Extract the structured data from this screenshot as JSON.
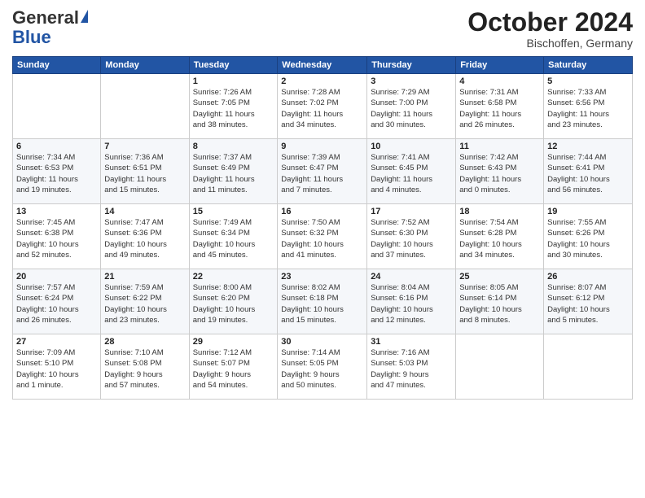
{
  "header": {
    "logo_general": "General",
    "logo_blue": "Blue",
    "month_title": "October 2024",
    "location": "Bischoffen, Germany"
  },
  "weekdays": [
    "Sunday",
    "Monday",
    "Tuesday",
    "Wednesday",
    "Thursday",
    "Friday",
    "Saturday"
  ],
  "weeks": [
    [
      {
        "day": "",
        "info": ""
      },
      {
        "day": "",
        "info": ""
      },
      {
        "day": "1",
        "info": "Sunrise: 7:26 AM\nSunset: 7:05 PM\nDaylight: 11 hours\nand 38 minutes."
      },
      {
        "day": "2",
        "info": "Sunrise: 7:28 AM\nSunset: 7:02 PM\nDaylight: 11 hours\nand 34 minutes."
      },
      {
        "day": "3",
        "info": "Sunrise: 7:29 AM\nSunset: 7:00 PM\nDaylight: 11 hours\nand 30 minutes."
      },
      {
        "day": "4",
        "info": "Sunrise: 7:31 AM\nSunset: 6:58 PM\nDaylight: 11 hours\nand 26 minutes."
      },
      {
        "day": "5",
        "info": "Sunrise: 7:33 AM\nSunset: 6:56 PM\nDaylight: 11 hours\nand 23 minutes."
      }
    ],
    [
      {
        "day": "6",
        "info": "Sunrise: 7:34 AM\nSunset: 6:53 PM\nDaylight: 11 hours\nand 19 minutes."
      },
      {
        "day": "7",
        "info": "Sunrise: 7:36 AM\nSunset: 6:51 PM\nDaylight: 11 hours\nand 15 minutes."
      },
      {
        "day": "8",
        "info": "Sunrise: 7:37 AM\nSunset: 6:49 PM\nDaylight: 11 hours\nand 11 minutes."
      },
      {
        "day": "9",
        "info": "Sunrise: 7:39 AM\nSunset: 6:47 PM\nDaylight: 11 hours\nand 7 minutes."
      },
      {
        "day": "10",
        "info": "Sunrise: 7:41 AM\nSunset: 6:45 PM\nDaylight: 11 hours\nand 4 minutes."
      },
      {
        "day": "11",
        "info": "Sunrise: 7:42 AM\nSunset: 6:43 PM\nDaylight: 11 hours\nand 0 minutes."
      },
      {
        "day": "12",
        "info": "Sunrise: 7:44 AM\nSunset: 6:41 PM\nDaylight: 10 hours\nand 56 minutes."
      }
    ],
    [
      {
        "day": "13",
        "info": "Sunrise: 7:45 AM\nSunset: 6:38 PM\nDaylight: 10 hours\nand 52 minutes."
      },
      {
        "day": "14",
        "info": "Sunrise: 7:47 AM\nSunset: 6:36 PM\nDaylight: 10 hours\nand 49 minutes."
      },
      {
        "day": "15",
        "info": "Sunrise: 7:49 AM\nSunset: 6:34 PM\nDaylight: 10 hours\nand 45 minutes."
      },
      {
        "day": "16",
        "info": "Sunrise: 7:50 AM\nSunset: 6:32 PM\nDaylight: 10 hours\nand 41 minutes."
      },
      {
        "day": "17",
        "info": "Sunrise: 7:52 AM\nSunset: 6:30 PM\nDaylight: 10 hours\nand 37 minutes."
      },
      {
        "day": "18",
        "info": "Sunrise: 7:54 AM\nSunset: 6:28 PM\nDaylight: 10 hours\nand 34 minutes."
      },
      {
        "day": "19",
        "info": "Sunrise: 7:55 AM\nSunset: 6:26 PM\nDaylight: 10 hours\nand 30 minutes."
      }
    ],
    [
      {
        "day": "20",
        "info": "Sunrise: 7:57 AM\nSunset: 6:24 PM\nDaylight: 10 hours\nand 26 minutes."
      },
      {
        "day": "21",
        "info": "Sunrise: 7:59 AM\nSunset: 6:22 PM\nDaylight: 10 hours\nand 23 minutes."
      },
      {
        "day": "22",
        "info": "Sunrise: 8:00 AM\nSunset: 6:20 PM\nDaylight: 10 hours\nand 19 minutes."
      },
      {
        "day": "23",
        "info": "Sunrise: 8:02 AM\nSunset: 6:18 PM\nDaylight: 10 hours\nand 15 minutes."
      },
      {
        "day": "24",
        "info": "Sunrise: 8:04 AM\nSunset: 6:16 PM\nDaylight: 10 hours\nand 12 minutes."
      },
      {
        "day": "25",
        "info": "Sunrise: 8:05 AM\nSunset: 6:14 PM\nDaylight: 10 hours\nand 8 minutes."
      },
      {
        "day": "26",
        "info": "Sunrise: 8:07 AM\nSunset: 6:12 PM\nDaylight: 10 hours\nand 5 minutes."
      }
    ],
    [
      {
        "day": "27",
        "info": "Sunrise: 7:09 AM\nSunset: 5:10 PM\nDaylight: 10 hours\nand 1 minute."
      },
      {
        "day": "28",
        "info": "Sunrise: 7:10 AM\nSunset: 5:08 PM\nDaylight: 9 hours\nand 57 minutes."
      },
      {
        "day": "29",
        "info": "Sunrise: 7:12 AM\nSunset: 5:07 PM\nDaylight: 9 hours\nand 54 minutes."
      },
      {
        "day": "30",
        "info": "Sunrise: 7:14 AM\nSunset: 5:05 PM\nDaylight: 9 hours\nand 50 minutes."
      },
      {
        "day": "31",
        "info": "Sunrise: 7:16 AM\nSunset: 5:03 PM\nDaylight: 9 hours\nand 47 minutes."
      },
      {
        "day": "",
        "info": ""
      },
      {
        "day": "",
        "info": ""
      }
    ]
  ]
}
